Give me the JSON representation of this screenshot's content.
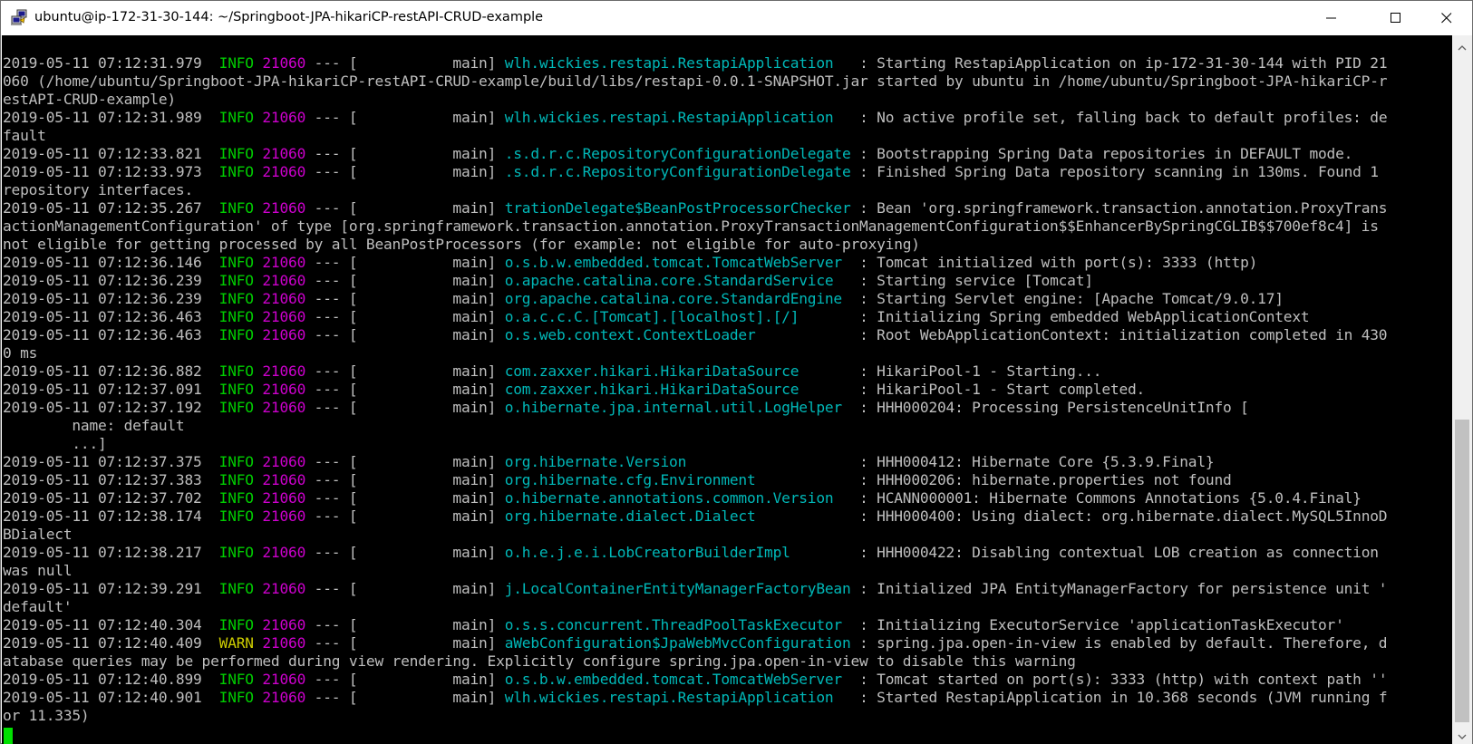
{
  "window": {
    "title": "ubuntu@ip-172-31-30-144: ~/Springboot-JPA-hikariCP-restAPI-CRUD-example",
    "icons": {
      "app": "putty-icon",
      "minimize": "minimize-icon",
      "maximize": "maximize-icon",
      "close": "close-icon"
    }
  },
  "colors": {
    "background": "#000000",
    "text": "#bfbfbf",
    "info": "#00cd00",
    "warn": "#cdcd00",
    "pid": "#cd00cd",
    "logger": "#00b8b8",
    "cursor": "#00e000"
  },
  "terminal": {
    "lines": [
      [
        {
          "t": "2019-05-11 07:12:31.979  "
        },
        {
          "t": "INFO",
          "c": "lvl-info"
        },
        {
          "t": " "
        },
        {
          "t": "21060",
          "c": "pid"
        },
        {
          "t": " --- [           main] "
        },
        {
          "t": "wlh.wickies.restapi.RestapiApplication",
          "c": "logger"
        },
        {
          "t": "   : Starting RestapiApplication on ip-172-31-30-144 with PID 21"
        }
      ],
      [
        {
          "t": "060 (/home/ubuntu/Springboot-JPA-hikariCP-restAPI-CRUD-example/build/libs/restapi-0.0.1-SNAPSHOT.jar started by ubuntu in /home/ubuntu/Springboot-JPA-hikariCP-r"
        }
      ],
      [
        {
          "t": "estAPI-CRUD-example)"
        }
      ],
      [
        {
          "t": "2019-05-11 07:12:31.989  "
        },
        {
          "t": "INFO",
          "c": "lvl-info"
        },
        {
          "t": " "
        },
        {
          "t": "21060",
          "c": "pid"
        },
        {
          "t": " --- [           main] "
        },
        {
          "t": "wlh.wickies.restapi.RestapiApplication",
          "c": "logger"
        },
        {
          "t": "   : No active profile set, falling back to default profiles: de"
        }
      ],
      [
        {
          "t": "fault"
        }
      ],
      [
        {
          "t": "2019-05-11 07:12:33.821  "
        },
        {
          "t": "INFO",
          "c": "lvl-info"
        },
        {
          "t": " "
        },
        {
          "t": "21060",
          "c": "pid"
        },
        {
          "t": " --- [           main] "
        },
        {
          "t": ".s.d.r.c.RepositoryConfigurationDelegate",
          "c": "logger"
        },
        {
          "t": " : Bootstrapping Spring Data repositories in DEFAULT mode."
        }
      ],
      [
        {
          "t": "2019-05-11 07:12:33.973  "
        },
        {
          "t": "INFO",
          "c": "lvl-info"
        },
        {
          "t": " "
        },
        {
          "t": "21060",
          "c": "pid"
        },
        {
          "t": " --- [           main] "
        },
        {
          "t": ".s.d.r.c.RepositoryConfigurationDelegate",
          "c": "logger"
        },
        {
          "t": " : Finished Spring Data repository scanning in 130ms. Found 1"
        }
      ],
      [
        {
          "t": "repository interfaces."
        }
      ],
      [
        {
          "t": "2019-05-11 07:12:35.267  "
        },
        {
          "t": "INFO",
          "c": "lvl-info"
        },
        {
          "t": " "
        },
        {
          "t": "21060",
          "c": "pid"
        },
        {
          "t": " --- [           main] "
        },
        {
          "t": "trationDelegate$BeanPostProcessorChecker",
          "c": "logger"
        },
        {
          "t": " : Bean 'org.springframework.transaction.annotation.ProxyTrans"
        }
      ],
      [
        {
          "t": "actionManagementConfiguration' of type [org.springframework.transaction.annotation.ProxyTransactionManagementConfiguration$$EnhancerBySpringCGLIB$$700ef8c4] is"
        }
      ],
      [
        {
          "t": "not eligible for getting processed by all BeanPostProcessors (for example: not eligible for auto-proxying)"
        }
      ],
      [
        {
          "t": "2019-05-11 07:12:36.146  "
        },
        {
          "t": "INFO",
          "c": "lvl-info"
        },
        {
          "t": " "
        },
        {
          "t": "21060",
          "c": "pid"
        },
        {
          "t": " --- [           main] "
        },
        {
          "t": "o.s.b.w.embedded.tomcat.TomcatWebServer",
          "c": "logger"
        },
        {
          "t": "  : Tomcat initialized with port(s): 3333 (http)"
        }
      ],
      [
        {
          "t": "2019-05-11 07:12:36.239  "
        },
        {
          "t": "INFO",
          "c": "lvl-info"
        },
        {
          "t": " "
        },
        {
          "t": "21060",
          "c": "pid"
        },
        {
          "t": " --- [           main] "
        },
        {
          "t": "o.apache.catalina.core.StandardService",
          "c": "logger"
        },
        {
          "t": "   : Starting service [Tomcat]"
        }
      ],
      [
        {
          "t": "2019-05-11 07:12:36.239  "
        },
        {
          "t": "INFO",
          "c": "lvl-info"
        },
        {
          "t": " "
        },
        {
          "t": "21060",
          "c": "pid"
        },
        {
          "t": " --- [           main] "
        },
        {
          "t": "org.apache.catalina.core.StandardEngine",
          "c": "logger"
        },
        {
          "t": "  : Starting Servlet engine: [Apache Tomcat/9.0.17]"
        }
      ],
      [
        {
          "t": "2019-05-11 07:12:36.463  "
        },
        {
          "t": "INFO",
          "c": "lvl-info"
        },
        {
          "t": " "
        },
        {
          "t": "21060",
          "c": "pid"
        },
        {
          "t": " --- [           main] "
        },
        {
          "t": "o.a.c.c.C.[Tomcat].[localhost].[/]",
          "c": "logger"
        },
        {
          "t": "       : Initializing Spring embedded WebApplicationContext"
        }
      ],
      [
        {
          "t": "2019-05-11 07:12:36.463  "
        },
        {
          "t": "INFO",
          "c": "lvl-info"
        },
        {
          "t": " "
        },
        {
          "t": "21060",
          "c": "pid"
        },
        {
          "t": " --- [           main] "
        },
        {
          "t": "o.s.web.context.ContextLoader",
          "c": "logger"
        },
        {
          "t": "            : Root WebApplicationContext: initialization completed in 430"
        }
      ],
      [
        {
          "t": "0 ms"
        }
      ],
      [
        {
          "t": "2019-05-11 07:12:36.882  "
        },
        {
          "t": "INFO",
          "c": "lvl-info"
        },
        {
          "t": " "
        },
        {
          "t": "21060",
          "c": "pid"
        },
        {
          "t": " --- [           main] "
        },
        {
          "t": "com.zaxxer.hikari.HikariDataSource",
          "c": "logger"
        },
        {
          "t": "       : HikariPool-1 - Starting..."
        }
      ],
      [
        {
          "t": "2019-05-11 07:12:37.091  "
        },
        {
          "t": "INFO",
          "c": "lvl-info"
        },
        {
          "t": " "
        },
        {
          "t": "21060",
          "c": "pid"
        },
        {
          "t": " --- [           main] "
        },
        {
          "t": "com.zaxxer.hikari.HikariDataSource",
          "c": "logger"
        },
        {
          "t": "       : HikariPool-1 - Start completed."
        }
      ],
      [
        {
          "t": "2019-05-11 07:12:37.192  "
        },
        {
          "t": "INFO",
          "c": "lvl-info"
        },
        {
          "t": " "
        },
        {
          "t": "21060",
          "c": "pid"
        },
        {
          "t": " --- [           main] "
        },
        {
          "t": "o.hibernate.jpa.internal.util.LogHelper",
          "c": "logger"
        },
        {
          "t": "  : HHH000204: Processing PersistenceUnitInfo ["
        }
      ],
      [
        {
          "t": "        name: default"
        }
      ],
      [
        {
          "t": "        ...]"
        }
      ],
      [
        {
          "t": "2019-05-11 07:12:37.375  "
        },
        {
          "t": "INFO",
          "c": "lvl-info"
        },
        {
          "t": " "
        },
        {
          "t": "21060",
          "c": "pid"
        },
        {
          "t": " --- [           main] "
        },
        {
          "t": "org.hibernate.Version",
          "c": "logger"
        },
        {
          "t": "                    : HHH000412: Hibernate Core {5.3.9.Final}"
        }
      ],
      [
        {
          "t": "2019-05-11 07:12:37.383  "
        },
        {
          "t": "INFO",
          "c": "lvl-info"
        },
        {
          "t": " "
        },
        {
          "t": "21060",
          "c": "pid"
        },
        {
          "t": " --- [           main] "
        },
        {
          "t": "org.hibernate.cfg.Environment",
          "c": "logger"
        },
        {
          "t": "            : HHH000206: hibernate.properties not found"
        }
      ],
      [
        {
          "t": "2019-05-11 07:12:37.702  "
        },
        {
          "t": "INFO",
          "c": "lvl-info"
        },
        {
          "t": " "
        },
        {
          "t": "21060",
          "c": "pid"
        },
        {
          "t": " --- [           main] "
        },
        {
          "t": "o.hibernate.annotations.common.Version",
          "c": "logger"
        },
        {
          "t": "   : HCANN000001: Hibernate Commons Annotations {5.0.4.Final}"
        }
      ],
      [
        {
          "t": "2019-05-11 07:12:38.174  "
        },
        {
          "t": "INFO",
          "c": "lvl-info"
        },
        {
          "t": " "
        },
        {
          "t": "21060",
          "c": "pid"
        },
        {
          "t": " --- [           main] "
        },
        {
          "t": "org.hibernate.dialect.Dialect",
          "c": "logger"
        },
        {
          "t": "            : HHH000400: Using dialect: org.hibernate.dialect.MySQL5InnoD"
        }
      ],
      [
        {
          "t": "BDialect"
        }
      ],
      [
        {
          "t": "2019-05-11 07:12:38.217  "
        },
        {
          "t": "INFO",
          "c": "lvl-info"
        },
        {
          "t": " "
        },
        {
          "t": "21060",
          "c": "pid"
        },
        {
          "t": " --- [           main] "
        },
        {
          "t": "o.h.e.j.e.i.LobCreatorBuilderImpl",
          "c": "logger"
        },
        {
          "t": "        : HHH000422: Disabling contextual LOB creation as connection"
        }
      ],
      [
        {
          "t": "was null"
        }
      ],
      [
        {
          "t": "2019-05-11 07:12:39.291  "
        },
        {
          "t": "INFO",
          "c": "lvl-info"
        },
        {
          "t": " "
        },
        {
          "t": "21060",
          "c": "pid"
        },
        {
          "t": " --- [           main] "
        },
        {
          "t": "j.LocalContainerEntityManagerFactoryBean",
          "c": "logger"
        },
        {
          "t": " : Initialized JPA EntityManagerFactory for persistence unit '"
        }
      ],
      [
        {
          "t": "default'"
        }
      ],
      [
        {
          "t": "2019-05-11 07:12:40.304  "
        },
        {
          "t": "INFO",
          "c": "lvl-info"
        },
        {
          "t": " "
        },
        {
          "t": "21060",
          "c": "pid"
        },
        {
          "t": " --- [           main] "
        },
        {
          "t": "o.s.s.concurrent.ThreadPoolTaskExecutor",
          "c": "logger"
        },
        {
          "t": "  : Initializing ExecutorService 'applicationTaskExecutor'"
        }
      ],
      [
        {
          "t": "2019-05-11 07:12:40.409  "
        },
        {
          "t": "WARN",
          "c": "lvl-warn"
        },
        {
          "t": " "
        },
        {
          "t": "21060",
          "c": "pid"
        },
        {
          "t": " --- [           main] "
        },
        {
          "t": "aWebConfiguration$JpaWebMvcConfiguration",
          "c": "logger"
        },
        {
          "t": " : spring.jpa.open-in-view is enabled by default. Therefore, d"
        }
      ],
      [
        {
          "t": "atabase queries may be performed during view rendering. Explicitly configure spring.jpa.open-in-view to disable this warning"
        }
      ],
      [
        {
          "t": "2019-05-11 07:12:40.899  "
        },
        {
          "t": "INFO",
          "c": "lvl-info"
        },
        {
          "t": " "
        },
        {
          "t": "21060",
          "c": "pid"
        },
        {
          "t": " --- [           main] "
        },
        {
          "t": "o.s.b.w.embedded.tomcat.TomcatWebServer",
          "c": "logger"
        },
        {
          "t": "  : Tomcat started on port(s): 3333 (http) with context path ''"
        }
      ],
      [
        {
          "t": "2019-05-11 07:12:40.901  "
        },
        {
          "t": "INFO",
          "c": "lvl-info"
        },
        {
          "t": " "
        },
        {
          "t": "21060",
          "c": "pid"
        },
        {
          "t": " --- [           main] "
        },
        {
          "t": "wlh.wickies.restapi.RestapiApplication",
          "c": "logger"
        },
        {
          "t": "   : Started RestapiApplication in 10.368 seconds (JVM running f"
        }
      ],
      [
        {
          "t": "or 11.335)"
        }
      ]
    ]
  }
}
